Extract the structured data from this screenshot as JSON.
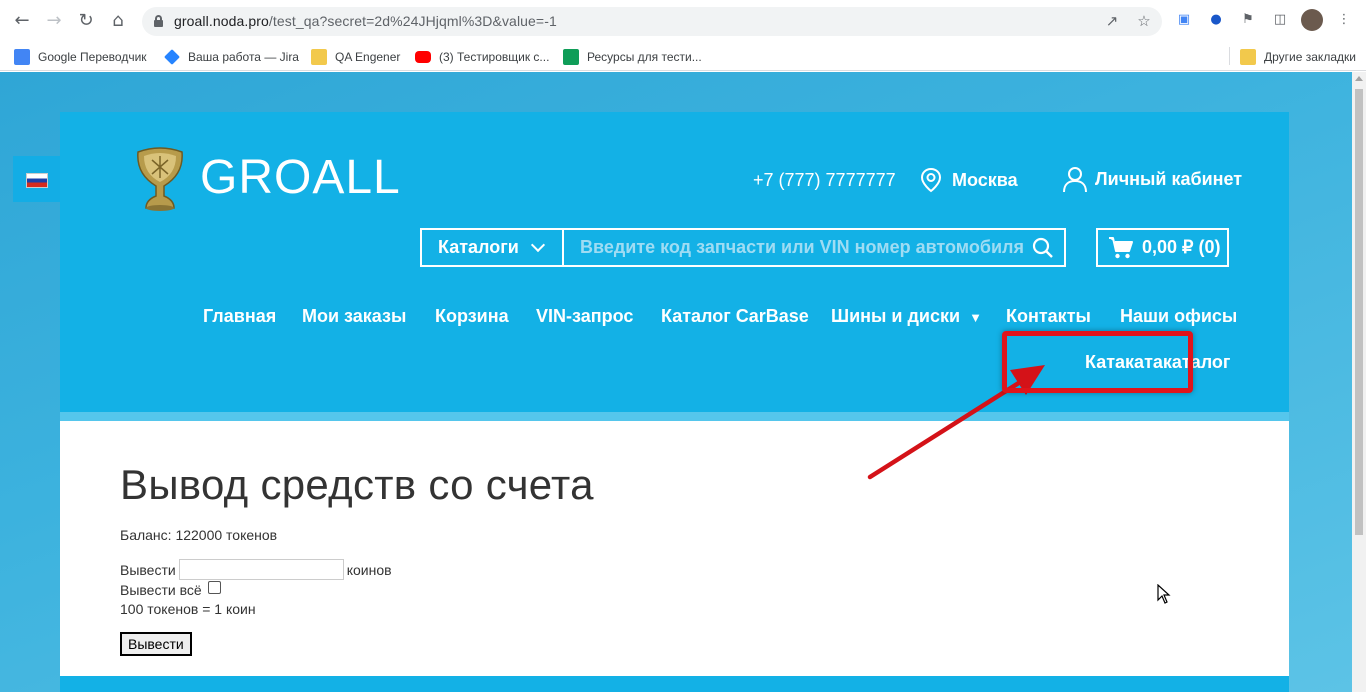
{
  "browser": {
    "url_host": "groall.noda.pro",
    "url_path": "/test_qa?secret=2d%24JHjqml%3D&value=-1",
    "bookmarks": [
      {
        "label": "Google Переводчик",
        "icon": "google-translate-icon",
        "color": "#4285f4"
      },
      {
        "label": "Ваша работа — Jira",
        "icon": "jira-icon",
        "color": "#2684ff"
      },
      {
        "label": "QA Engener",
        "icon": "folder-icon",
        "color": "#f2c94c"
      },
      {
        "label": "(3) Тестировщик с...",
        "icon": "youtube-icon",
        "color": "#ff0000"
      },
      {
        "label": "Ресурсы для тести...",
        "icon": "sheets-icon",
        "color": "#0f9d58"
      }
    ],
    "other_bookmarks": "Другие закладки"
  },
  "site": {
    "logo_text": "GROALL",
    "phone": "+7 (777) 7777777",
    "city": "Москва",
    "cabinet": "Личный кабинет",
    "catalogs_label": "Каталоги",
    "search_placeholder": "Введите код запчасти или VIN номер автомобиля",
    "cart": "0,00 ₽ (0)",
    "menu": [
      "Главная",
      "Мои заказы",
      "Корзина",
      "VIN-запрос",
      "Каталог CarBase",
      "Шины и диски",
      "Контакты",
      "Наши офисы"
    ],
    "menu_dropdown_marker": "▼",
    "menu_extra": "Катакатакаталог",
    "accent_color": "#13b1e6",
    "highlight_color": "#e0141b"
  },
  "content": {
    "title": "Вывод средств со счета",
    "balance": "Баланс: 122000 токенов",
    "withdraw_label": "Вывести",
    "withdraw_unit": "коинов",
    "withdraw_all_label": "Вывести всё",
    "rate": "100 токенов = 1 коин",
    "submit_label": "Вывести"
  }
}
